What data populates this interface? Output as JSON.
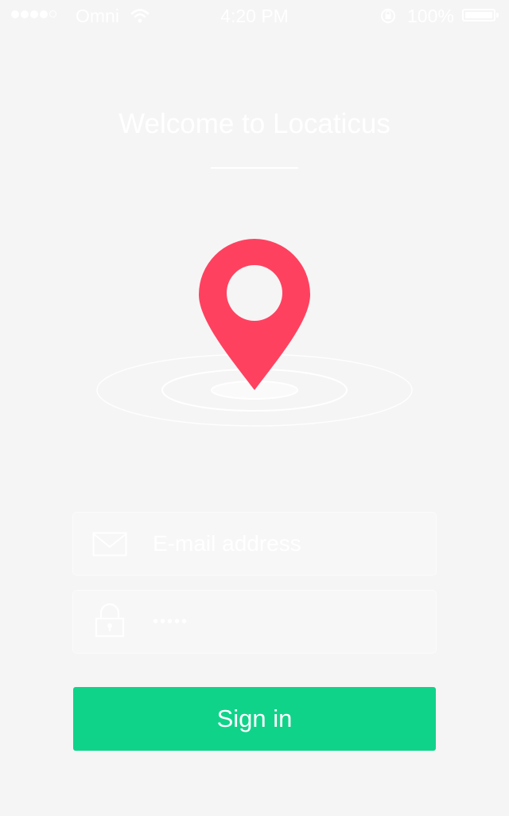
{
  "status_bar": {
    "carrier": "Omni",
    "time": "4:20 PM",
    "battery_percent": "100%",
    "battery_level": 1.0,
    "signal_bars": 5,
    "signal_filled": 4
  },
  "title": "Welcome to Locaticus",
  "pin_graphic": {
    "icon": "location-pin-icon",
    "pin_color": "#ff4160"
  },
  "email_field": {
    "icon": "mail-icon",
    "placeholder": "E-mail address",
    "value": ""
  },
  "password_field": {
    "icon": "lock-icon",
    "value": "•••••"
  },
  "sign_in_button": {
    "label": "Sign in",
    "color": "#10d38a"
  }
}
